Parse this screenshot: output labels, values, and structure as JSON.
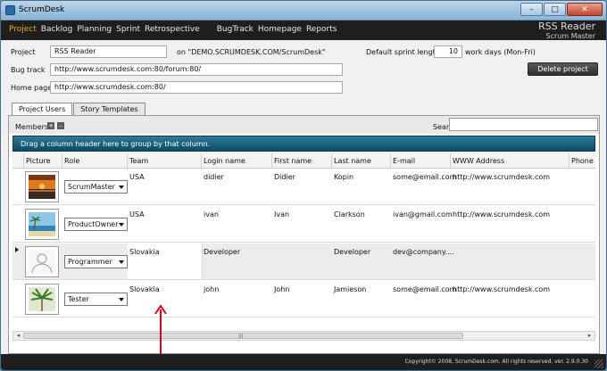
{
  "window": {
    "title": "ScrumDesk",
    "minimize": "–",
    "maximize": "□",
    "close": "✕"
  },
  "menu": {
    "items": [
      {
        "label": "Project",
        "active": true
      },
      {
        "label": "Backlog"
      },
      {
        "label": "Planning"
      },
      {
        "label": "Sprint"
      },
      {
        "label": "Retrospective"
      },
      {
        "label": "BugTrack"
      },
      {
        "label": "Homepage"
      },
      {
        "label": "Reports"
      }
    ]
  },
  "brand": {
    "project_name": "RSS Reader",
    "user_role": "Scrum Master"
  },
  "project_form": {
    "project_label": "Project",
    "project_value": "RSS Reader",
    "on_text": "on \"DEMO.SCRUMDESK.COM/ScrumDesk\"",
    "sprint_length_label": "Default sprint length",
    "sprint_length_value": "10",
    "sprint_length_unit": "work days (Mon-Fri)",
    "bugtrack_label": "Bug track",
    "bugtrack_value": "http://www.scrumdesk.com:80/forum:80/",
    "homepage_label": "Home page",
    "homepage_value": "http://www.scrumdesk.com:80/",
    "delete_button": "Delete project"
  },
  "tabs": [
    {
      "label": "Project Users",
      "active": true
    },
    {
      "label": "Story Templates"
    }
  ],
  "members": {
    "label": "Members",
    "add": "+",
    "remove": "–",
    "search_label": "Search for",
    "search_value": ""
  },
  "grid": {
    "group_hint": "Drag a column header here to group by that column.",
    "columns": [
      "Picture",
      "Role",
      "Team",
      "Login name",
      "First name",
      "Last name",
      "E-mail",
      "WWW Address",
      "Phone"
    ],
    "rows": [
      {
        "picture": "sunset-photo",
        "role": "ScrumMaster",
        "team": "USA",
        "login": "didier",
        "first": "Didier",
        "last": "Kopin",
        "email": "some@email.com",
        "www": "http://www.scrumdesk.com",
        "selected": false
      },
      {
        "picture": "beach-photo",
        "role": "ProductOwner",
        "team": "USA",
        "login": "ivan",
        "first": "Ivan",
        "last": "Clarkson",
        "email": "ivan@gmail.com",
        "www": "http://www.scrumdesk.com",
        "selected": false
      },
      {
        "picture": "person-silhouette",
        "role": "Programmer",
        "team": "Slovakia",
        "login": "Developer",
        "first": "",
        "last": "Developer",
        "email": "dev@company....",
        "www": "",
        "selected": true
      },
      {
        "picture": "palm-photo",
        "role": "Tester",
        "team": "Slovakia",
        "login": "john",
        "first": "John",
        "last": "Jamieson",
        "email": "some@email.com",
        "www": "http://www.scrumdesk.com",
        "selected": false
      }
    ]
  },
  "scroll": {
    "left": "◂",
    "right": "▸",
    "grip": "III"
  },
  "status": {
    "copyright": "Copyright© 2008, ScrumDesk.com. All rights reserved. ver. 2.9.0.30"
  },
  "colors": {
    "menubar": "#1e1e1e",
    "active_menu": "#f3a51c",
    "group_bar": "#0a4a66",
    "annotation_arrow": "#e0001b"
  }
}
